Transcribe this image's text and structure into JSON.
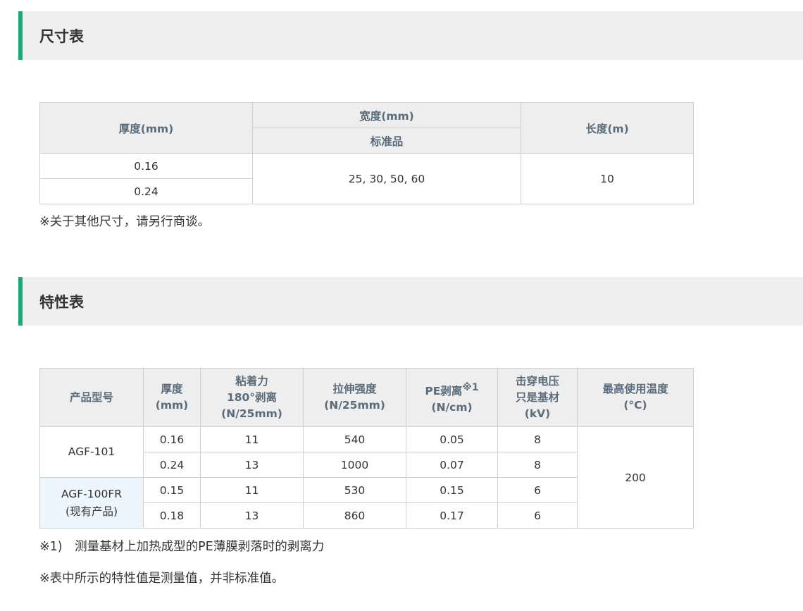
{
  "sections": {
    "size": {
      "title": "尺寸表"
    },
    "properties": {
      "title": "特性表"
    }
  },
  "size_table": {
    "headers": {
      "thickness": "厚度(mm)",
      "width": "宽度(mm)",
      "width_sub": "标准品",
      "length": "长度(m)"
    },
    "rows": [
      {
        "thickness": "0.16"
      },
      {
        "thickness": "0.24"
      }
    ],
    "width_value": "25, 30, 50, 60",
    "length_value": "10",
    "note": "※关于其他尺寸，请另行商谈。"
  },
  "property_table": {
    "headers": {
      "model": "产品型号",
      "thickness": [
        "厚度",
        "(mm)"
      ],
      "adhesion": [
        "粘着力",
        "180°剥离",
        "(N/25mm)"
      ],
      "tensile": [
        "拉伸强度",
        "(N/25mm)"
      ],
      "pe_peel": [
        "PE剥离",
        "※1",
        "(N/cm)"
      ],
      "breakdown": [
        "击穿电压",
        "只是基材",
        "(kV)"
      ],
      "max_temp": [
        "最高使用温度",
        "(°C)"
      ]
    },
    "products": [
      {
        "model": [
          "AGF-101"
        ],
        "rows": [
          {
            "thickness": "0.16",
            "adhesion": "11",
            "tensile": "540",
            "pe_peel": "0.05",
            "breakdown": "8"
          },
          {
            "thickness": "0.24",
            "adhesion": "13",
            "tensile": "1000",
            "pe_peel": "0.07",
            "breakdown": "8"
          }
        ]
      },
      {
        "model": [
          "AGF-100FR",
          "(现有产品)"
        ],
        "rows": [
          {
            "thickness": "0.15",
            "adhesion": "11",
            "tensile": "530",
            "pe_peel": "0.15",
            "breakdown": "6"
          },
          {
            "thickness": "0.18",
            "adhesion": "13",
            "tensile": "860",
            "pe_peel": "0.17",
            "breakdown": "6"
          }
        ]
      }
    ],
    "max_temp_value": "200",
    "notes": [
      "※1)　测量基材上加热成型的PE薄膜剥落时的剥离力",
      "※表中所示的特性值是测量值，并非标准值。"
    ]
  },
  "colors": {
    "accent": "#1aa97a",
    "header_bg": "#efefef",
    "table_header_bg": "#eeeeee",
    "table_header_text": "#5a6b7b",
    "highlight_cell": "#eef6fd"
  }
}
